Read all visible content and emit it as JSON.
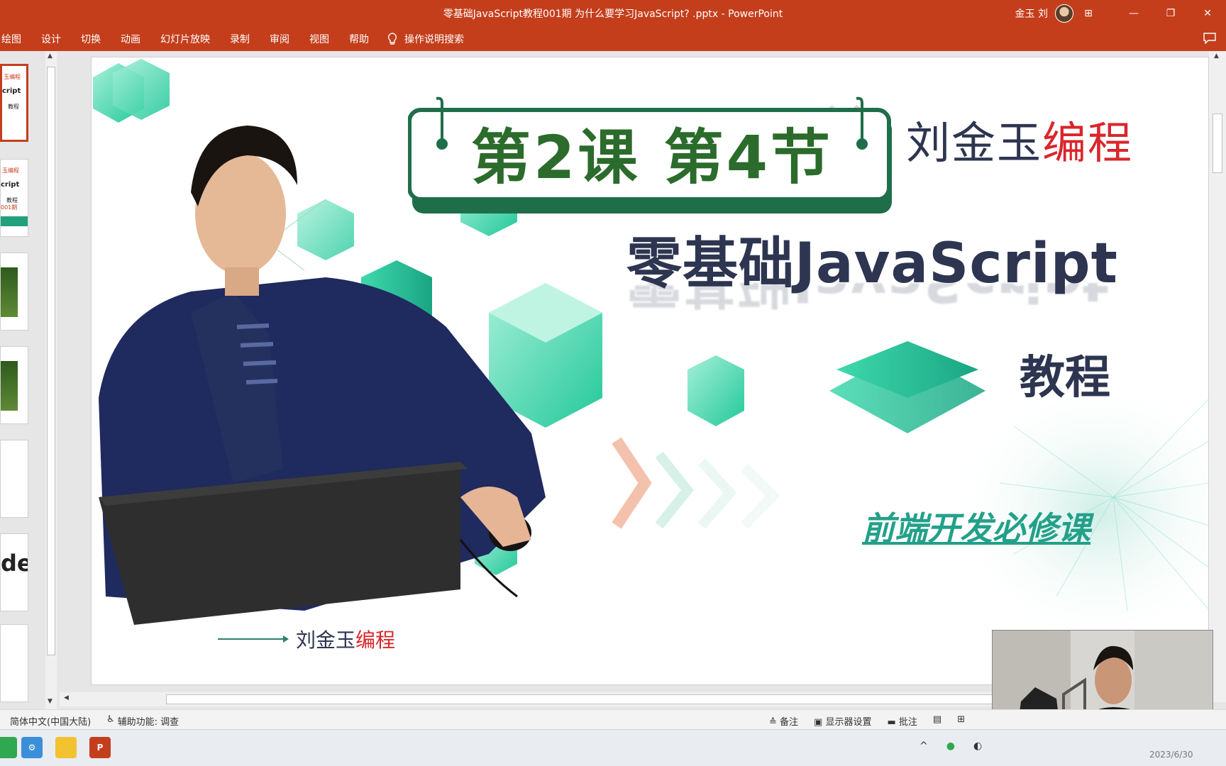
{
  "window": {
    "title": "零基础JavaScript教程001期 为什么要学习JavaScript? .pptx  -  PowerPoint",
    "user_name": "金玉 刘",
    "controls": {
      "minimize": "—",
      "restore": "❐",
      "close": "✕",
      "ribbon_display": "⊞"
    }
  },
  "ribbon": {
    "tabs": [
      "绘图",
      "设计",
      "切换",
      "动画",
      "幻灯片放映",
      "录制",
      "审阅",
      "视图",
      "帮助"
    ],
    "tell_me": "操作说明搜索"
  },
  "thumbnails": [
    {
      "line1": "玉编程",
      "line2": "cript",
      "line3": "教程"
    },
    {
      "line1": "玉编程",
      "line2": "cript",
      "line3": "教程",
      "line4": "001期"
    },
    {
      "type": "image"
    },
    {
      "type": "image"
    },
    {
      "type": "blank"
    },
    {
      "type": "code",
      "text": "de"
    },
    {
      "type": "blank"
    }
  ],
  "slide": {
    "sign_title": "第2课 第4节",
    "brand_name": "刘金玉",
    "brand_accent": "编程",
    "headline": "零基础JavaScript",
    "subtitle": "教程",
    "course_link": "前端开发必修课",
    "footer_name": "刘金玉",
    "footer_accent": "编程"
  },
  "statusbar": {
    "language": "简体中文(中国大陆)",
    "accessibility": "辅助功能: 调查",
    "notes": "备注",
    "display_settings": "显示器设置",
    "comments": "批注"
  },
  "taskbar": {
    "tray_chevron": "^",
    "clock": "2023/6/30"
  },
  "colors": {
    "office_red": "#c43e1c",
    "slide_navy": "#2d3550",
    "accent_red": "#d9262b",
    "teal": "#23a08a",
    "sign_green": "#2b6b2b"
  }
}
